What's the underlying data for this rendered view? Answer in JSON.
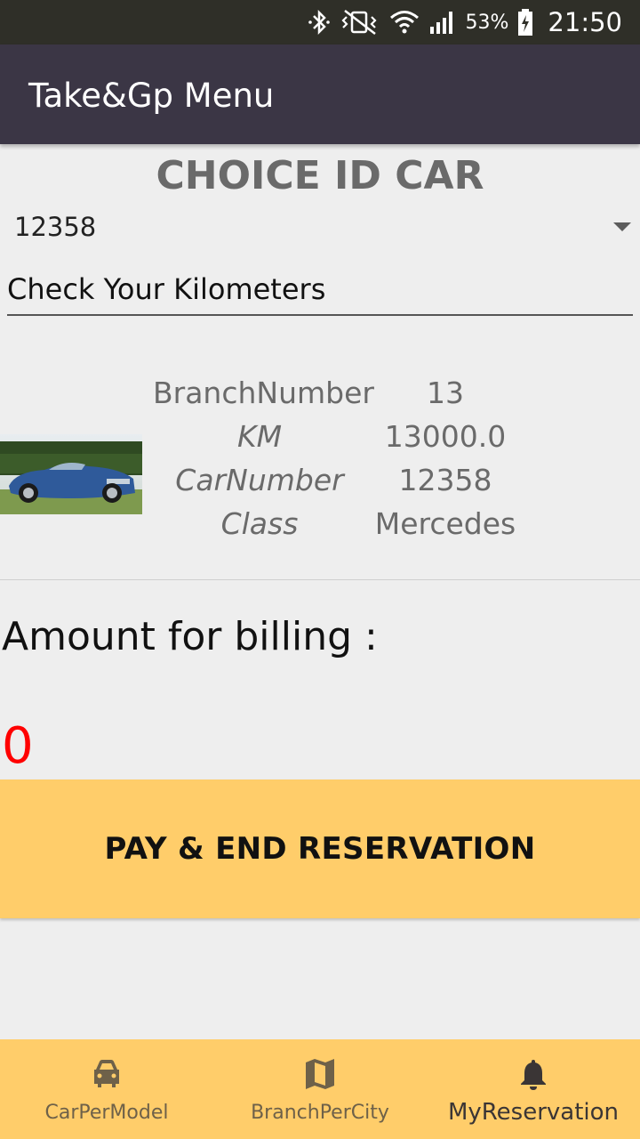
{
  "status_bar": {
    "battery_percent": "53%",
    "time": "21:50",
    "icons": [
      "bluetooth-icon",
      "vibrate-mute-icon",
      "wifi-icon",
      "signal-icon",
      "battery-charging-icon"
    ]
  },
  "app_bar": {
    "title": "Take&Gp Menu"
  },
  "main": {
    "heading": "CHOICE ID CAR",
    "car_select": {
      "selected": "12358"
    },
    "km_input": {
      "placeholder": "Check Your Kilometers",
      "value": ""
    },
    "details": [
      {
        "label": "BranchNumber",
        "value": "13"
      },
      {
        "label": "KM",
        "value": "13000.0"
      },
      {
        "label": "CarNumber",
        "value": "12358"
      },
      {
        "label": "Class",
        "value": "Mercedes"
      }
    ],
    "amount_label": "Amount for billing :",
    "amount_value": "0",
    "pay_button_label": "PAY & END RESERVATION"
  },
  "bottom_nav": {
    "items": [
      {
        "label": "CarPerModel",
        "icon": "car-icon",
        "active": false
      },
      {
        "label": "BranchPerCity",
        "icon": "map-icon",
        "active": false
      },
      {
        "label": "MyReservation",
        "icon": "bell-icon",
        "active": true
      }
    ]
  },
  "colors": {
    "app_bar": "#3b3645",
    "status_bar": "#2f2f28",
    "accent": "#ffcd6a",
    "amount": "#ff0000",
    "background": "#eeeeee"
  }
}
